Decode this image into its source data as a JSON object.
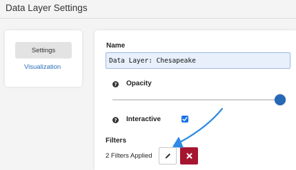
{
  "dialog": {
    "title": "Data Layer Settings"
  },
  "sidebar": {
    "items": [
      {
        "label": "Settings",
        "active": true
      },
      {
        "label": "Visualization",
        "active": false
      }
    ]
  },
  "form": {
    "name_label": "Name",
    "name_value": "Data Layer: Chesapeake",
    "opacity_label": "Opacity",
    "opacity_value": 1.0,
    "interactive_label": "Interactive",
    "interactive_checked": true,
    "filters_label": "Filters",
    "filters_status": "2 Filters Applied",
    "help_glyph": "?"
  },
  "icons": {
    "help": "question-circle-icon",
    "edit": "pencil-icon",
    "delete": "times-icon",
    "check": "checkmark-icon"
  },
  "colors": {
    "accent": "#2568b6",
    "link": "#2a6db8",
    "delete_button": "#a61530",
    "annotation_arrow": "#2d8ae6"
  }
}
